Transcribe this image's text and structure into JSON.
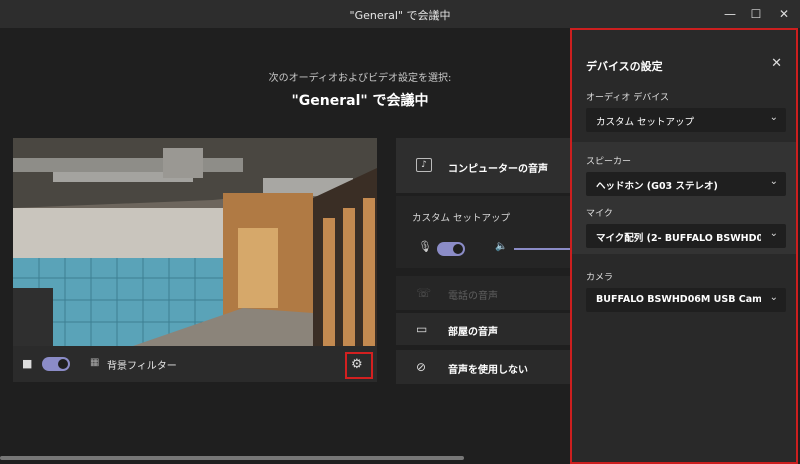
{
  "window": {
    "title": "\"General\" で会議中",
    "controls": {
      "minimize": "—",
      "maximize": "☐",
      "close": "✕"
    }
  },
  "main": {
    "subtitle": "次のオーディオおよびビデオ設定を選択:",
    "meeting_title": "\"General\" で会議中",
    "video": {
      "toggle_on": true,
      "background_filter": "背景フィルター"
    }
  },
  "audio_options": {
    "computer": "コンピューターの音声",
    "custom_setup": "カスタム セットアップ",
    "phone": "電話の音声",
    "room": "部屋の音声",
    "none": "音声を使用しない"
  },
  "device_panel": {
    "title": "デバイスの設定",
    "audio_device_label": "オーディオ デバイス",
    "audio_device_value": "カスタム セットアップ",
    "speaker_label": "スピーカー",
    "speaker_value": "ヘッドホン (G03 ステレオ)",
    "mic_label": "マイク",
    "mic_value": "マイク配列 (2- BUFFALO BSWHD0…",
    "camera_label": "カメラ",
    "camera_value": "BUFFALO BSWHD06M USB Cam…"
  },
  "colors": {
    "toggle": "#8b8cc7",
    "highlight": "#cc1f1f",
    "background": "#1f1f1f"
  }
}
